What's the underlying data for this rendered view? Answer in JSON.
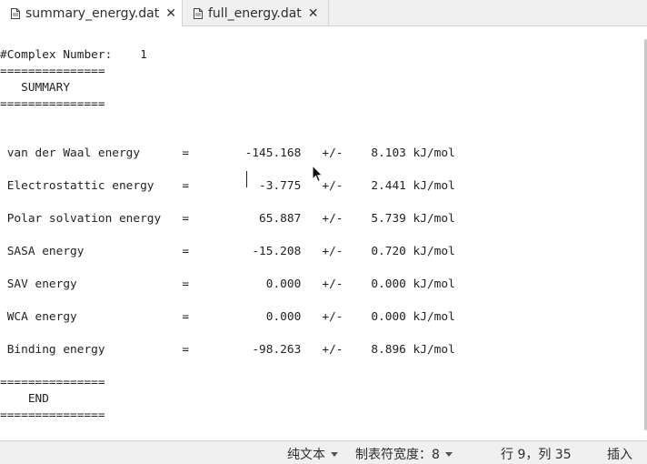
{
  "tabs": [
    {
      "label": "summary_energy.dat",
      "active": true
    },
    {
      "label": "full_energy.dat",
      "active": false
    }
  ],
  "icons": {
    "document": "document-icon",
    "close": "close-icon",
    "pointer": "mouse-pointer-icon"
  },
  "editor": {
    "lines": [
      "#Complex Number:    1",
      "===============",
      "   SUMMARY",
      "===============",
      "",
      "",
      " van der Waal energy      =        -145.168   +/-    8.103 kJ/mol",
      "",
      " Electrostattic energy    =          -3.775   +/-    2.441 kJ/mol",
      "",
      " Polar solvation energy   =          65.887   +/-    5.739 kJ/mol",
      "",
      " SASA energy              =         -15.208   +/-    0.720 kJ/mol",
      "",
      " SAV energy               =           0.000   +/-    0.000 kJ/mol",
      "",
      " WCA energy               =           0.000   +/-    0.000 kJ/mol",
      "",
      " Binding energy           =         -98.263   +/-    8.896 kJ/mol",
      "",
      "===============",
      "    END",
      "==============="
    ]
  },
  "status": {
    "syntax": "纯文本",
    "tab_width": "制表符宽度：8",
    "position": "行 9，列 35",
    "mode": "插入"
  }
}
